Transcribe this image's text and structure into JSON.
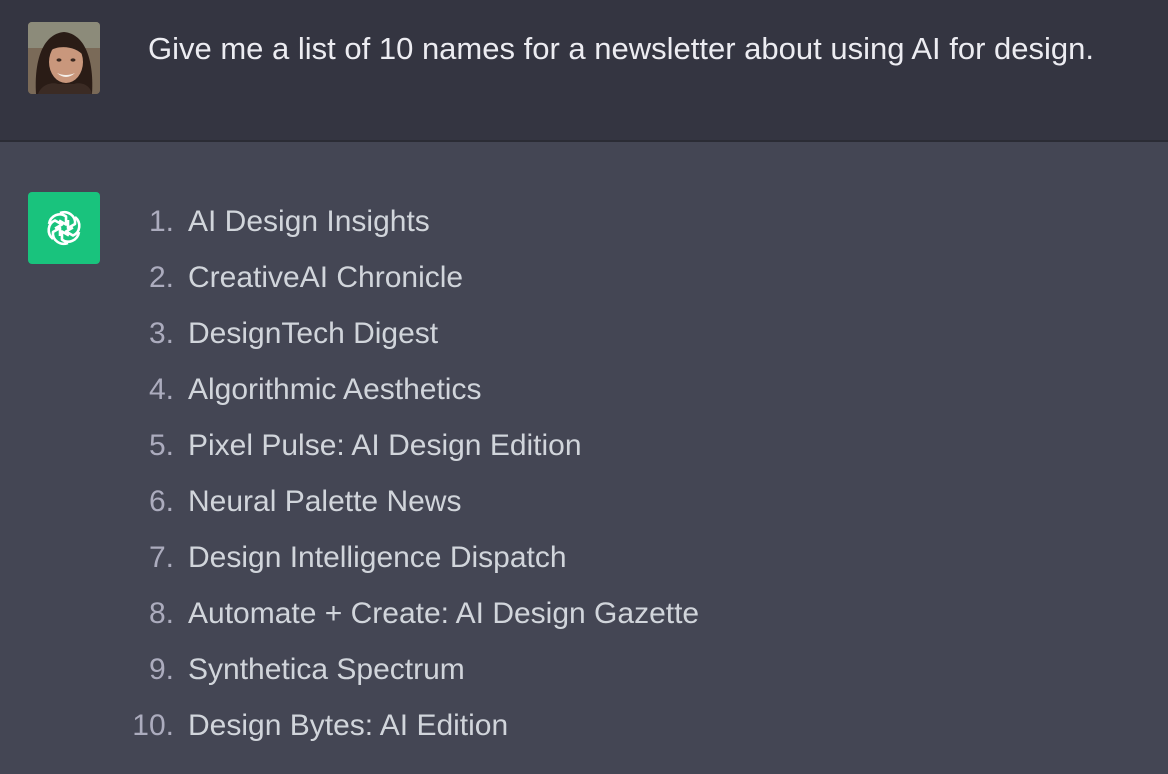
{
  "user_message": {
    "text": "Give me a list of 10 names for a newsletter about using AI for design."
  },
  "assistant_message": {
    "items": [
      {
        "number": "1.",
        "text": "AI Design Insights"
      },
      {
        "number": "2.",
        "text": "CreativeAI Chronicle"
      },
      {
        "number": "3.",
        "text": "DesignTech Digest"
      },
      {
        "number": "4.",
        "text": "Algorithmic Aesthetics"
      },
      {
        "number": "5.",
        "text": "Pixel Pulse: AI Design Edition"
      },
      {
        "number": "6.",
        "text": "Neural Palette News"
      },
      {
        "number": "7.",
        "text": "Design Intelligence Dispatch"
      },
      {
        "number": "8.",
        "text": "Automate + Create: AI Design Gazette"
      },
      {
        "number": "9.",
        "text": "Synthetica Spectrum"
      },
      {
        "number": "10.",
        "text": "Design Bytes: AI Edition"
      }
    ]
  },
  "colors": {
    "user_background": "#343541",
    "assistant_background": "#444654",
    "assistant_icon_background": "#19c37d"
  },
  "icons": {
    "user_avatar": "user-avatar",
    "assistant_avatar": "openai-logo-icon"
  }
}
